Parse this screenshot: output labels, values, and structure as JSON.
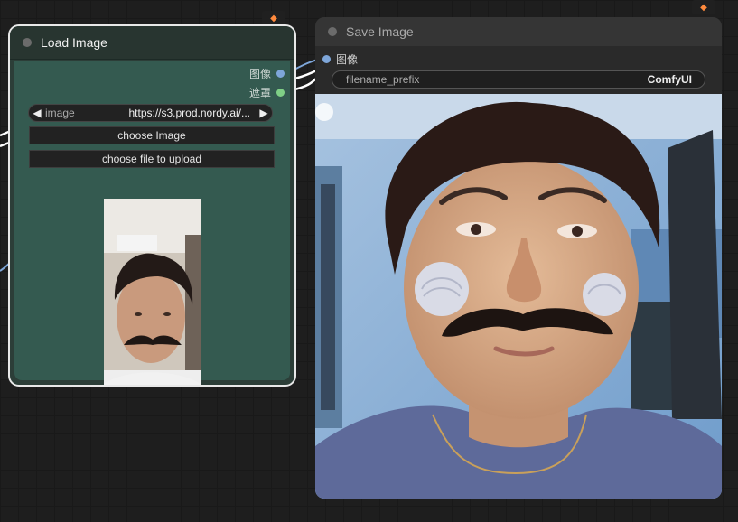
{
  "load_node": {
    "title": "Load Image",
    "outputs": [
      {
        "label": "图像",
        "color": "#7ea6d9"
      },
      {
        "label": "遮罩",
        "color": "#7fcf86"
      }
    ],
    "image_widget": {
      "name": "image",
      "value": "https://s3.prod.nordy.ai/..."
    },
    "choose_image_label": "choose Image",
    "upload_label": "choose file to upload",
    "preview_alt": "webcam selfie with drawn mustache"
  },
  "save_node": {
    "title": "Save Image",
    "input_label": "图像",
    "filename_prefix": {
      "name": "filename_prefix",
      "value": "ComfyUI"
    }
  },
  "badges": {
    "icon": "fox-icon"
  }
}
